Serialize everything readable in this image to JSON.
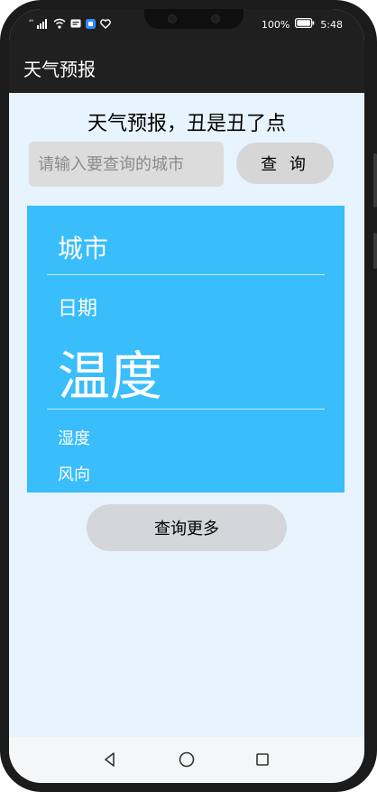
{
  "status_bar": {
    "signal_text": "⁴⁶",
    "battery_percent": "100%",
    "time": "5:48"
  },
  "app_bar": {
    "title": "天气预报"
  },
  "main": {
    "heading": "天气预报，丑是丑了点",
    "search_placeholder": "请输入要查询的城市",
    "query_button": "查 询",
    "more_button": "查询更多"
  },
  "card": {
    "city": "城市",
    "date": "日期",
    "temperature": "温度",
    "humidity": "湿度",
    "wind": "风向"
  },
  "colors": {
    "card_background": "#39bdfb",
    "page_background": "#e8f4fd",
    "app_bar": "#202020"
  },
  "icons": {
    "status": [
      "signal-icon",
      "wifi-icon",
      "notification-icon",
      "app-badge-icon",
      "heart-icon",
      "battery-icon"
    ],
    "nav": [
      "back-icon",
      "home-icon",
      "recents-icon"
    ]
  }
}
